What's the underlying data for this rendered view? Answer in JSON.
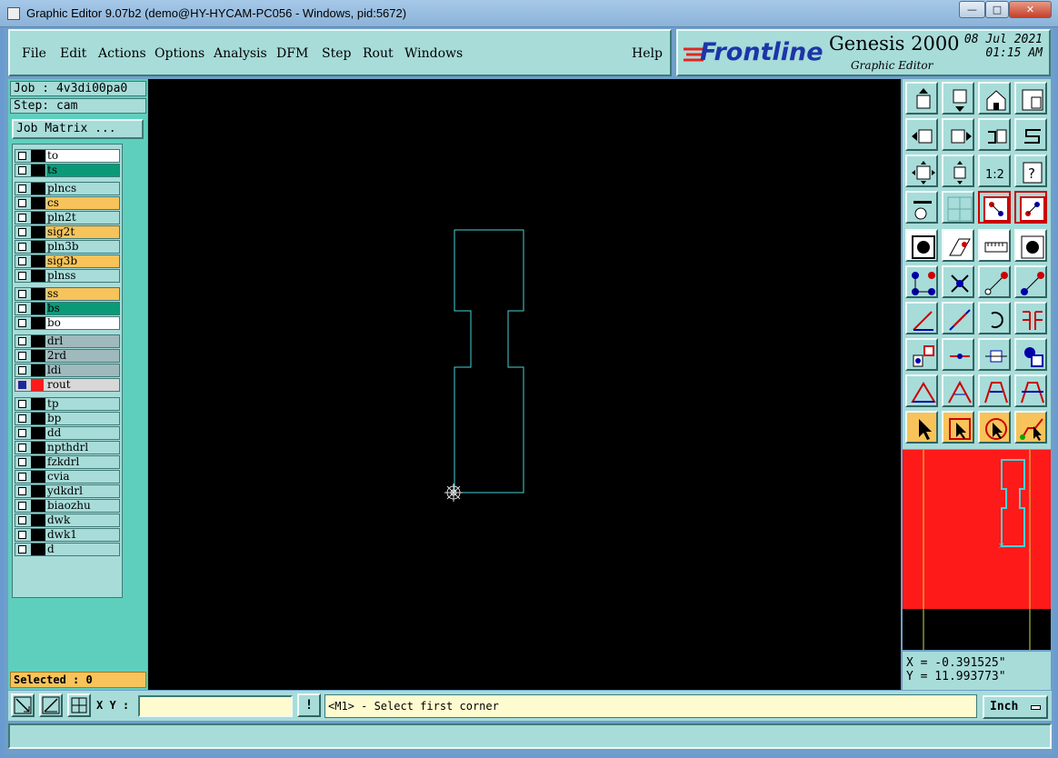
{
  "window": {
    "title": "Graphic Editor 9.07b2 (demo@HY-HYCAM-PC056 - Windows, pid:5672)",
    "minimize": "—",
    "maximize": "□",
    "close": "✕"
  },
  "menu": {
    "file": "File",
    "edit": "Edit",
    "actions": "Actions",
    "options": "Options",
    "analysis": "Analysis",
    "dfm": "DFM",
    "step": "Step",
    "rout": "Rout",
    "windows": "Windows",
    "help": "Help"
  },
  "brand": {
    "logo": "Frontline",
    "product": "Genesis 2000",
    "subtitle": "Graphic Editor",
    "date": "08 Jul 2021",
    "time": "01:15 AM"
  },
  "job": {
    "job_label": "Job : 4v3di00pa0",
    "step_label": "Step: cam",
    "matrix_button": "Job Matrix ..."
  },
  "layers": [
    {
      "name": "to",
      "color": "#ffffff"
    },
    {
      "name": "ts",
      "color": "#0a9a78"
    },
    {
      "name": "plncs",
      "color": "#a7dcd9"
    },
    {
      "name": "cs",
      "color": "#f7c35a"
    },
    {
      "name": "pln2t",
      "color": "#a7dcd9"
    },
    {
      "name": "sig2t",
      "color": "#f7c35a"
    },
    {
      "name": "pln3b",
      "color": "#a7dcd9"
    },
    {
      "name": "sig3b",
      "color": "#f7c35a"
    },
    {
      "name": "plnss",
      "color": "#a7dcd9"
    },
    {
      "name": "ss",
      "color": "#f7c35a"
    },
    {
      "name": "bs",
      "color": "#0a9a78"
    },
    {
      "name": "bo",
      "color": "#ffffff"
    },
    {
      "name": "drl",
      "color": "#9fb9bd"
    },
    {
      "name": "2rd",
      "color": "#9fb9bd"
    },
    {
      "name": "ldi",
      "color": "#9fb9bd"
    },
    {
      "name": "rout",
      "color": "#d8d8d8",
      "active": true
    },
    {
      "name": "tp",
      "color": "#a7dcd9"
    },
    {
      "name": "bp",
      "color": "#a7dcd9"
    },
    {
      "name": "dd",
      "color": "#a7dcd9"
    },
    {
      "name": "npthdrl",
      "color": "#a7dcd9"
    },
    {
      "name": "fzkdrl",
      "color": "#a7dcd9"
    },
    {
      "name": "cvia",
      "color": "#a7dcd9"
    },
    {
      "name": "ydkdrl",
      "color": "#a7dcd9"
    },
    {
      "name": "biaozhu",
      "color": "#a7dcd9"
    },
    {
      "name": "dwk",
      "color": "#a7dcd9"
    },
    {
      "name": "dwk1",
      "color": "#a7dcd9"
    },
    {
      "name": "d",
      "color": "#a7dcd9"
    }
  ],
  "selected": "Selected : 0",
  "coords": {
    "x": "X = -0.391525\"",
    "y": "Y = 11.993773\""
  },
  "bottom": {
    "xy_label": "X Y :",
    "xy_value": "",
    "warn": "!",
    "prompt": "<M1> - Select first corner",
    "unit": "Inch"
  },
  "status": "",
  "colors": {
    "panel": "#a7dcd9",
    "canvas": "#000000",
    "outline": "#49d0d6",
    "preview_red": "#ff1a1a",
    "highlight": "#f7c35a"
  }
}
